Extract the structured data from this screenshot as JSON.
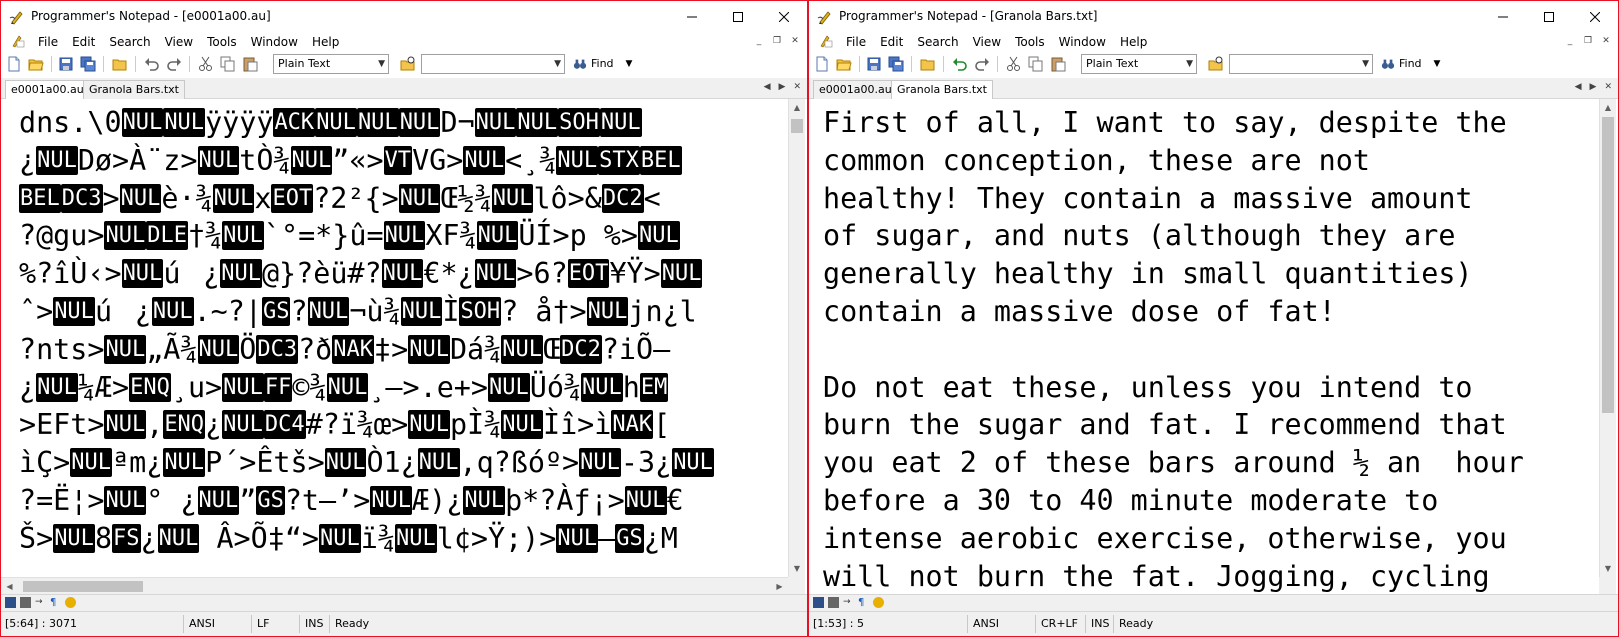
{
  "colors": {
    "active_border": "#e81123",
    "control_char_bg": "#000000",
    "control_char_fg": "#ffffff"
  },
  "left": {
    "title": "Programmer's Notepad - [e0001a00.au]",
    "menu": [
      "File",
      "Edit",
      "Search",
      "View",
      "Tools",
      "Window",
      "Help"
    ],
    "scheme_value": "Plain Text",
    "search_value": "",
    "find_label": "Find",
    "tabs": [
      "e0001a00.au",
      "Granola Bars.txt"
    ],
    "active_tab": 0,
    "lines": [
      [
        [
          "t",
          "dns.\\0"
        ],
        [
          "c",
          "NUL"
        ],
        [
          "c",
          "NUL"
        ],
        [
          "t",
          "ÿÿÿÿ"
        ],
        [
          "c",
          "ACK"
        ],
        [
          "c",
          "NUL"
        ],
        [
          "c",
          "NUL"
        ],
        [
          "c",
          "NUL"
        ],
        [
          "t",
          "D¬"
        ],
        [
          "c",
          "NUL"
        ],
        [
          "c",
          "NUL"
        ],
        [
          "c",
          "SOH"
        ],
        [
          "c",
          "NUL"
        ]
      ],
      [
        [
          "t",
          "¿"
        ],
        [
          "c",
          "NUL"
        ],
        [
          "t",
          "Dø>À¨z>"
        ],
        [
          "c",
          "NUL"
        ],
        [
          "t",
          "tÒ¾"
        ],
        [
          "c",
          "NUL"
        ],
        [
          "t",
          "”«>"
        ],
        [
          "c",
          "VT"
        ],
        [
          "t",
          "VG>"
        ],
        [
          "c",
          "NUL"
        ],
        [
          "t",
          "<¸¾"
        ],
        [
          "c",
          "NUL"
        ],
        [
          "c",
          "STX"
        ],
        [
          "c",
          "BEL"
        ]
      ],
      [
        [
          "c",
          "BEL"
        ],
        [
          "c",
          "DC3"
        ],
        [
          "t",
          ">"
        ],
        [
          "c",
          "NUL"
        ],
        [
          "t",
          "è·¾"
        ],
        [
          "c",
          "NUL"
        ],
        [
          "t",
          "x"
        ],
        [
          "c",
          "EOT"
        ],
        [
          "t",
          "?2²{>"
        ],
        [
          "c",
          "NUL"
        ],
        [
          "t",
          "Œ½¾"
        ],
        [
          "c",
          "NUL"
        ],
        [
          "t",
          "lô>&"
        ],
        [
          "c",
          "DC2"
        ],
        [
          "t",
          "<"
        ]
      ],
      [
        [
          "t",
          "?@gu>"
        ],
        [
          "c",
          "NUL"
        ],
        [
          "c",
          "DLE"
        ],
        [
          "t",
          "†¾"
        ],
        [
          "c",
          "NUL"
        ],
        [
          "t",
          "`°=*}û="
        ],
        [
          "c",
          "NUL"
        ],
        [
          "t",
          "XF¾"
        ],
        [
          "c",
          "NUL"
        ],
        [
          "t",
          "ÜÍ>p %>"
        ],
        [
          "c",
          "NUL"
        ]
      ],
      [
        [
          "t",
          "%?îÙ‹>"
        ],
        [
          "c",
          "NUL"
        ],
        [
          "t",
          "ú¿"
        ],
        [
          "c",
          "NUL"
        ],
        [
          "t",
          "@}?èü#?"
        ],
        [
          "c",
          "NUL"
        ],
        [
          "t",
          "€*¿"
        ],
        [
          "c",
          "NUL"
        ],
        [
          "t",
          ">6?"
        ],
        [
          "c",
          "EOT"
        ],
        [
          "t",
          "¥Ÿ>"
        ],
        [
          "c",
          "NUL"
        ]
      ],
      [
        [
          "t",
          "ˆ>"
        ],
        [
          "c",
          "NUL"
        ],
        [
          "t",
          "ú¿"
        ],
        [
          "c",
          "NUL"
        ],
        [
          "t",
          ".~?|"
        ],
        [
          "c",
          "GS"
        ],
        [
          "t",
          "?"
        ],
        [
          "c",
          "NUL"
        ],
        [
          "t",
          "¬ù¾"
        ],
        [
          "c",
          "NUL"
        ],
        [
          "t",
          "Ì"
        ],
        [
          "c",
          "SOH"
        ],
        [
          "t",
          "? å†>"
        ],
        [
          "c",
          "NUL"
        ],
        [
          "t",
          "jn¿l"
        ]
      ],
      [
        [
          "t",
          "?nts>"
        ],
        [
          "c",
          "NUL"
        ],
        [
          "t",
          "„Ã¾"
        ],
        [
          "c",
          "NUL"
        ],
        [
          "t",
          "Ö"
        ],
        [
          "c",
          "DC3"
        ],
        [
          "t",
          "?ð"
        ],
        [
          "c",
          "NAK"
        ],
        [
          "t",
          "‡>"
        ],
        [
          "c",
          "NUL"
        ],
        [
          "t",
          "Dá¾"
        ],
        [
          "c",
          "NUL"
        ],
        [
          "t",
          "Œ"
        ],
        [
          "c",
          "DC2"
        ],
        [
          "t",
          "?iÕ–"
        ]
      ],
      [
        [
          "t",
          "¿"
        ],
        [
          "c",
          "NUL"
        ],
        [
          "t",
          "¼Æ>"
        ],
        [
          "c",
          "ENQ"
        ],
        [
          "t",
          "¸u>"
        ],
        [
          "c",
          "NUL"
        ],
        [
          "c",
          "FF"
        ],
        [
          "t",
          "©¾"
        ],
        [
          "c",
          "NUL"
        ],
        [
          "t",
          "¸–>.e+>"
        ],
        [
          "c",
          "NUL"
        ],
        [
          "t",
          "Üó¾"
        ],
        [
          "c",
          "NUL"
        ],
        [
          "t",
          "h"
        ],
        [
          "c",
          "EM"
        ]
      ],
      [
        [
          "t",
          ">EFt>"
        ],
        [
          "c",
          "NUL"
        ],
        [
          "t",
          ","
        ],
        [
          "c",
          "ENQ"
        ],
        [
          "t",
          "¿"
        ],
        [
          "c",
          "NUL"
        ],
        [
          "c",
          "DC4"
        ],
        [
          "t",
          "#?ï¾œ>"
        ],
        [
          "c",
          "NUL"
        ],
        [
          "t",
          "pÌ¾"
        ],
        [
          "c",
          "NUL"
        ],
        [
          "t",
          "Ìî>ì"
        ],
        [
          "c",
          "NAK"
        ],
        [
          "t",
          "["
        ]
      ],
      [
        [
          "t",
          "ìÇ>"
        ],
        [
          "c",
          "NUL"
        ],
        [
          "t",
          "ªm¿"
        ],
        [
          "c",
          "NUL"
        ],
        [
          "t",
          "P´>Êtš>"
        ],
        [
          "c",
          "NUL"
        ],
        [
          "t",
          "Ò1¿"
        ],
        [
          "c",
          "NUL"
        ],
        [
          "t",
          ",q?ßóº>"
        ],
        [
          "c",
          "NUL"
        ],
        [
          "t",
          "-3¿"
        ],
        [
          "c",
          "NUL"
        ]
      ],
      [
        [
          "t",
          "?=Ë¦>"
        ],
        [
          "c",
          "NUL"
        ],
        [
          "t",
          "° ¿"
        ],
        [
          "c",
          "NUL"
        ],
        [
          "t",
          "”"
        ],
        [
          "c",
          "GS"
        ],
        [
          "t",
          "?t–’>"
        ],
        [
          "c",
          "NUL"
        ],
        [
          "t",
          "Æ)¿"
        ],
        [
          "c",
          "NUL"
        ],
        [
          "t",
          "þ*?Àƒ¡>"
        ],
        [
          "c",
          "NUL"
        ],
        [
          "t",
          "€"
        ]
      ],
      [
        [
          "t",
          "Š>"
        ],
        [
          "c",
          "NUL"
        ],
        [
          "t",
          "8"
        ],
        [
          "c",
          "FS"
        ],
        [
          "t",
          "¿"
        ],
        [
          "c",
          "NUL"
        ],
        [
          "t",
          " Â>Õ‡“>"
        ],
        [
          "c",
          "NUL"
        ],
        [
          "t",
          "ï¾"
        ],
        [
          "c",
          "NUL"
        ],
        [
          "t",
          "l¢>Ÿ;)>"
        ],
        [
          "c",
          "NUL"
        ],
        [
          "t",
          "–"
        ],
        [
          "c",
          "GS"
        ],
        [
          "t",
          "¿M"
        ]
      ]
    ],
    "status": {
      "position": "[5:64] : 3071",
      "encoding": "ANSI",
      "line_ending": "LF",
      "mode": "INS",
      "state": "Ready"
    }
  },
  "right": {
    "title": "Programmer's Notepad - [Granola Bars.txt]",
    "menu": [
      "File",
      "Edit",
      "Search",
      "View",
      "Tools",
      "Window",
      "Help"
    ],
    "scheme_value": "Plain Text",
    "search_value": "",
    "find_label": "Find",
    "tabs": [
      "e0001a00.au",
      "Granola Bars.txt"
    ],
    "active_tab": 1,
    "text_lines": [
      "First of all, I want to say, despite the",
      "common conception, these are not",
      "healthy! They contain a massive amount",
      "of sugar, and nuts (although they are",
      "generally healthy in small quantities)",
      "contain a massive dose of fat!",
      "",
      "Do not eat these, unless you intend to",
      "burn the sugar and fat. I recommend that",
      "you eat 2 of these bars around ½ an  hour",
      "before a 30 to 40 minute moderate to",
      "intense aerobic exercise, otherwise, you",
      "will not burn the fat. Jogging, cycling"
    ],
    "status": {
      "position": "[1:53] : 5",
      "encoding": "ANSI",
      "line_ending": "CR+LF",
      "mode": "INS",
      "state": "Ready"
    }
  }
}
